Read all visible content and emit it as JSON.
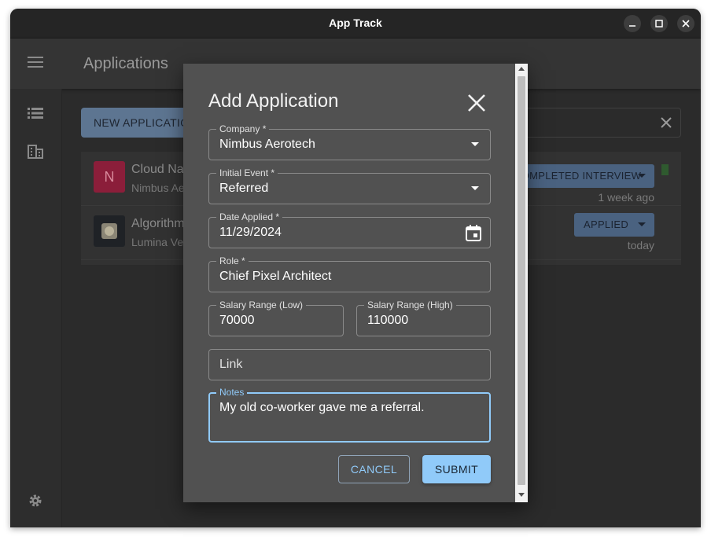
{
  "window": {
    "title": "App Track"
  },
  "appbar": {
    "title": "Applications"
  },
  "toolbar": {
    "new_button": "NEW APPLICATION"
  },
  "applications": [
    {
      "avatar_letter": "N",
      "avatar_color": "#8b1e3a",
      "title": "Cloud Na",
      "company": "Nimbus Ae",
      "status": "COMPLETED INTERVIEW",
      "date": "1 week ago"
    },
    {
      "avatar_letter": "",
      "avatar_color": "#1f2226",
      "title": "Algorithm",
      "company": "Lumina Ve",
      "status": "APPLIED",
      "date": "today"
    }
  ],
  "dialog": {
    "title": "Add Application",
    "company": {
      "label": "Company *",
      "value": "Nimbus Aerotech"
    },
    "initial_event": {
      "label": "Initial Event *",
      "value": "Referred"
    },
    "date_applied": {
      "label": "Date Applied *",
      "value": "11/29/2024"
    },
    "role": {
      "label": "Role *",
      "value": "Chief Pixel Architect"
    },
    "salary_low": {
      "label": "Salary Range (Low)",
      "value": "70000"
    },
    "salary_high": {
      "label": "Salary Range (High)",
      "value": "110000"
    },
    "link": {
      "label": "Link",
      "value": ""
    },
    "notes": {
      "label": "Notes",
      "value": "My old co-worker gave me a referral."
    },
    "cancel_label": "CANCEL",
    "submit_label": "SUBMIT"
  },
  "colors": {
    "accent": "#90caf9",
    "dialog_bg": "#515151"
  }
}
